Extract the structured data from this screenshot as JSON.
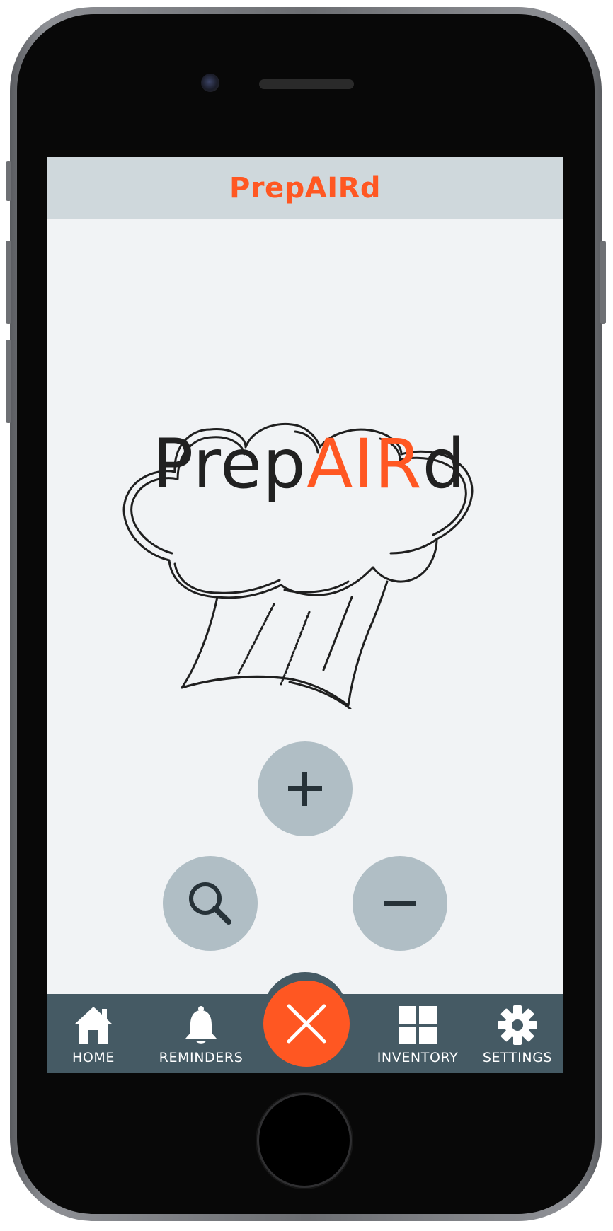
{
  "header": {
    "title": "PrepAIRd"
  },
  "logo": {
    "text_prefix": "Prep",
    "text_accent": "AIR",
    "text_suffix": "d"
  },
  "actions": {
    "add": "+",
    "search": "search-icon",
    "remove": "−"
  },
  "nav": {
    "items": [
      {
        "label": "HOME",
        "icon": "home-icon"
      },
      {
        "label": "REMINDERS",
        "icon": "bell-icon"
      },
      {
        "label": "INVENTORY",
        "icon": "grid-icon"
      },
      {
        "label": "SETTINGS",
        "icon": "gear-icon"
      }
    ],
    "fab_icon": "close-icon"
  },
  "colors": {
    "accent": "#ff5722",
    "header_bg": "#cfd8dc",
    "nav_bg": "#455a64",
    "button_bg": "#b0bec5",
    "screen_bg": "#f1f3f5"
  }
}
